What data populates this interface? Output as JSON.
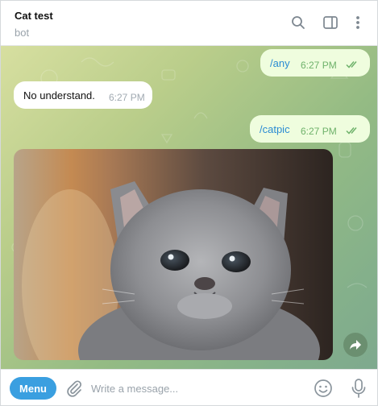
{
  "header": {
    "title": "Cat test",
    "status": "bot",
    "icons": [
      "search-icon",
      "sidebar-toggle-icon",
      "more-vertical-icon"
    ]
  },
  "messages": [
    {
      "direction": "outgoing",
      "text": "/any",
      "time": "6:27 PM",
      "status": "read"
    },
    {
      "direction": "incoming",
      "text": "No understand.",
      "time": "6:27 PM"
    },
    {
      "direction": "outgoing",
      "text": "/catpic",
      "time": "6:27 PM",
      "status": "read"
    },
    {
      "direction": "incoming",
      "type": "photo",
      "subject": "gray kitten"
    }
  ],
  "composer": {
    "menu_label": "Menu",
    "placeholder": "Write a message...",
    "value": "",
    "icons": [
      "paperclip-icon",
      "emoji-icon",
      "microphone-icon"
    ]
  },
  "colors": {
    "accent": "#3a9fe0",
    "outgoing_bubble": "#effdde",
    "outgoing_text": "#2a8bd3",
    "read_ticks": "#6fb26b",
    "incoming_bubble": "#ffffff"
  }
}
